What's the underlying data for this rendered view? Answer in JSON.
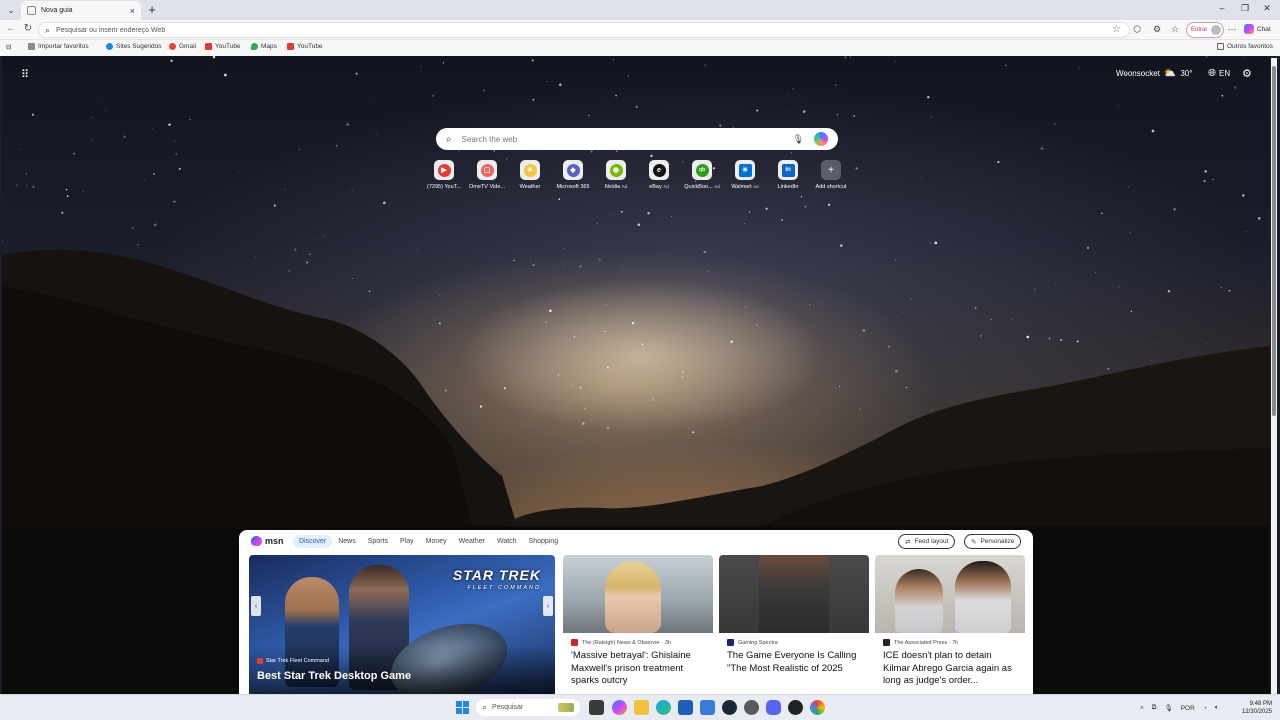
{
  "browser": {
    "tab": {
      "title": "Nova guia"
    },
    "address_placeholder": "Pesquisar ou inserir endereço Web",
    "signin_label": "Entrar",
    "copilot_label": "Chat",
    "bookmarks": [
      {
        "label": "Importar favoritos",
        "icon": "folder-import-icon",
        "color": "#6b6b6b"
      },
      {
        "label": "Sites Sugeridos",
        "icon": "edge-icon",
        "color": "#1e88e5"
      },
      {
        "label": "Gmail",
        "icon": "google-icon",
        "color": "#ea4335"
      },
      {
        "label": "YouTube",
        "icon": "youtube-icon",
        "color": "#e53935"
      },
      {
        "label": "Maps",
        "icon": "maps-pin-icon",
        "color": "#34a853"
      },
      {
        "label": "YouTube",
        "icon": "youtube-icon",
        "color": "#e53935"
      }
    ],
    "other_favorites": "Outros favoritos"
  },
  "ntp": {
    "weather": {
      "city": "Woonsocket",
      "temp": "30°"
    },
    "language": "EN",
    "search_placeholder": "Search the web",
    "shortcuts": [
      {
        "label": "(7295) YouT...",
        "ad": "",
        "icon": "youtube-icon",
        "color": "#e53935",
        "glyph": "▶"
      },
      {
        "label": "OmeTV Vide...",
        "ad": "",
        "icon": "ometv-icon",
        "color": "#f06262",
        "glyph": "▢"
      },
      {
        "label": "Weather",
        "ad": "",
        "icon": "weather-icon",
        "color": "#f5c542",
        "glyph": "☀"
      },
      {
        "label": "Microsoft 365",
        "ad": "",
        "icon": "m365-icon",
        "color": "#5b5fc7",
        "glyph": "◆"
      },
      {
        "label": "Nvidia",
        "ad": "Ad",
        "icon": "nvidia-icon",
        "color": "#76b900",
        "glyph": "◉"
      },
      {
        "label": "eBay",
        "ad": "Ad",
        "icon": "ebay-icon",
        "color": "#111111",
        "glyph": "e"
      },
      {
        "label": "QuickBoo...",
        "ad": "Ad",
        "icon": "quickbooks-icon",
        "color": "#2ca01c",
        "glyph": "qb"
      },
      {
        "label": "Walmart",
        "ad": "Ad",
        "icon": "walmart-icon",
        "color": "#0071ce",
        "glyph": "✳"
      },
      {
        "label": "LinkedIn",
        "ad": "",
        "icon": "linkedin-icon",
        "color": "#0a66c2",
        "glyph": "in"
      },
      {
        "label": "Add shortcut",
        "ad": "",
        "icon": "plus-icon",
        "color": "#ffffff",
        "glyph": "+"
      }
    ]
  },
  "feed": {
    "tabs": [
      "Discover",
      "News",
      "Sports",
      "Play",
      "Money",
      "Weather",
      "Watch",
      "Shopping"
    ],
    "feed_layout": "Feed layout",
    "personalize": "Personalize",
    "hero": {
      "logo_text": "STAR TREK",
      "logo_sub": "FLEET COMMAND",
      "source": "Star Trek Fleet Command",
      "title": "Best Star Trek Desktop Game"
    },
    "cards": [
      {
        "source": "The (Raleigh) News & Observer · 3h",
        "source_color": "#c62828",
        "headline": "'Massive betrayal': Ghislaine Maxwell's prison treatment sparks outcry"
      },
      {
        "source": "Gaming Spectra",
        "source_color": "#1a237e",
        "headline": "The Game Everyone Is Calling \"The Most Realistic of 2025"
      },
      {
        "source": "The Associated Press · 7h",
        "source_color": "#222222",
        "headline": "ICE doesn't plan to detain Kilmar Abrego Garcia again as long as judge's order..."
      }
    ]
  },
  "taskbar": {
    "search_placeholder": "Pesquisar",
    "lang": "POR",
    "time": "9:48 PM",
    "date": "12/30/2025"
  }
}
